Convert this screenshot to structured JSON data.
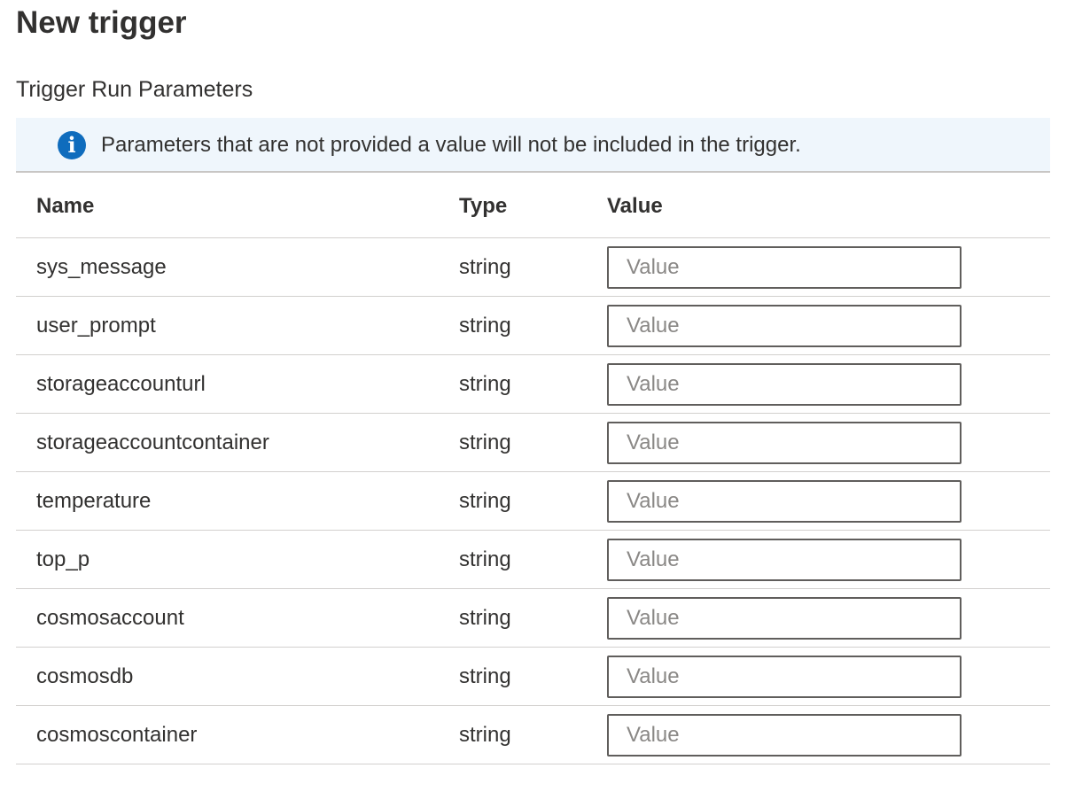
{
  "panel": {
    "title": "New trigger",
    "section_title": "Trigger Run Parameters",
    "info": {
      "icon": "info-icon",
      "icon_color": "#0f6cbd",
      "text": "Parameters that are not provided a value will not be included in the trigger."
    }
  },
  "table": {
    "headers": {
      "name": "Name",
      "type": "Type",
      "value": "Value"
    },
    "rows": [
      {
        "name": "sys_message",
        "type": "string",
        "value": "",
        "placeholder": "Value"
      },
      {
        "name": "user_prompt",
        "type": "string",
        "value": "",
        "placeholder": "Value"
      },
      {
        "name": "storageaccounturl",
        "type": "string",
        "value": "",
        "placeholder": "Value"
      },
      {
        "name": "storageaccountcontainer",
        "type": "string",
        "value": "",
        "placeholder": "Value"
      },
      {
        "name": "temperature",
        "type": "string",
        "value": "",
        "placeholder": "Value"
      },
      {
        "name": "top_p",
        "type": "string",
        "value": "",
        "placeholder": "Value"
      },
      {
        "name": "cosmosaccount",
        "type": "string",
        "value": "",
        "placeholder": "Value"
      },
      {
        "name": "cosmosdb",
        "type": "string",
        "value": "",
        "placeholder": "Value"
      },
      {
        "name": "cosmoscontainer",
        "type": "string",
        "value": "",
        "placeholder": "Value"
      }
    ]
  }
}
